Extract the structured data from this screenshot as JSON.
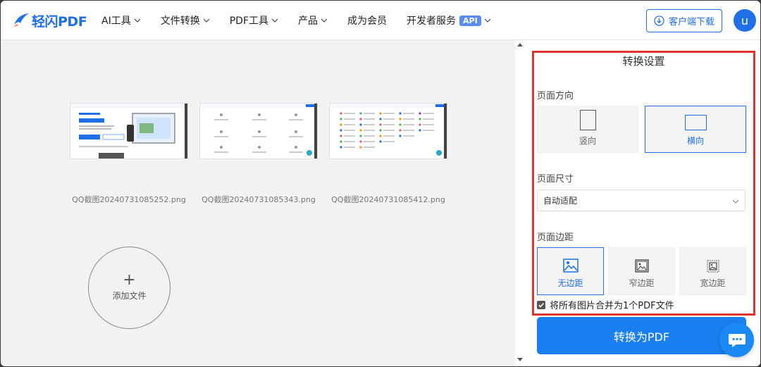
{
  "header": {
    "logo_text": "轻闪PDF",
    "nav": [
      {
        "label": "AI工具",
        "has_dropdown": true
      },
      {
        "label": "文件转换",
        "has_dropdown": true
      },
      {
        "label": "PDF工具",
        "has_dropdown": true
      },
      {
        "label": "产品",
        "has_dropdown": true
      },
      {
        "label": "成为会员",
        "has_dropdown": false
      },
      {
        "label": "开发者服务",
        "badge": "API",
        "has_dropdown": true
      }
    ],
    "download_label": "客户端下载",
    "avatar_initial": "u"
  },
  "files": [
    {
      "name": "QQ截图20240731085252.png"
    },
    {
      "name": "QQ截图20240731085343.png"
    },
    {
      "name": "QQ截图20240731085412.png"
    }
  ],
  "add_file_label": "添加文件",
  "settings": {
    "title": "转换设置",
    "orientation": {
      "label": "页面方向",
      "options": [
        "竖向",
        "横向"
      ],
      "selected": "横向"
    },
    "page_size": {
      "label": "页面尺寸",
      "value": "自动适配"
    },
    "margin": {
      "label": "页面边距",
      "options": [
        "无边距",
        "窄边距",
        "宽边距"
      ],
      "selected": "无边距"
    },
    "merge_label": "将所有图片合并为1个PDF文件",
    "merge_checked": true,
    "convert_label": "转换为PDF"
  },
  "colors": {
    "accent": "#1e6fe8",
    "highlight_box": "#e03333",
    "convert_button": "#1a7ff0"
  }
}
